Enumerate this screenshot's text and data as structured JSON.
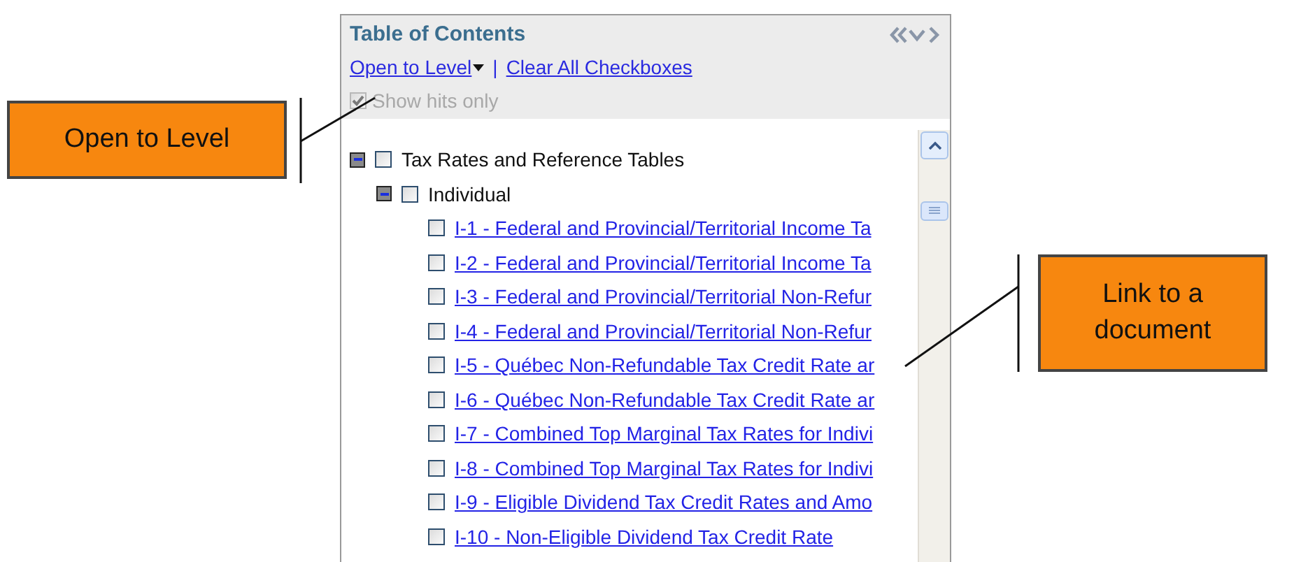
{
  "panel": {
    "title": "Table of Contents",
    "separator": "|",
    "toolbar": [
      {
        "label": "Open to Level",
        "has_menu": true
      },
      {
        "label": "Clear All Checkboxes",
        "has_menu": false
      }
    ],
    "show_hits_only": {
      "label": "Show hits only",
      "checked": true,
      "disabled": true
    },
    "tree": [
      {
        "label": "Tax Rates and Reference Tables",
        "kind": "folder",
        "expanded": true,
        "checked": false,
        "children": [
          {
            "label": "Individual",
            "kind": "folder",
            "expanded": true,
            "checked": false,
            "children": [
              {
                "label": "I-1 - Federal and Provincial/Territorial Income Ta",
                "kind": "link",
                "checked": false
              },
              {
                "label": "I-2 - Federal and Provincial/Territorial Income Ta",
                "kind": "link",
                "checked": false
              },
              {
                "label": "I-3 - Federal and Provincial/Territorial Non-Refur",
                "kind": "link",
                "checked": false
              },
              {
                "label": "I-4 - Federal and Provincial/Territorial Non-Refur",
                "kind": "link",
                "checked": false
              },
              {
                "label": "I-5 - Québec Non-Refundable Tax Credit Rate ar",
                "kind": "link",
                "checked": false
              },
              {
                "label": "I-6 - Québec Non-Refundable Tax Credit Rate ar",
                "kind": "link",
                "checked": false
              },
              {
                "label": "I-7 - Combined Top Marginal Tax Rates for Indivi",
                "kind": "link",
                "checked": false
              },
              {
                "label": "I-8 - Combined Top Marginal Tax Rates for Indivi",
                "kind": "link",
                "checked": false
              },
              {
                "label": "I-9 - Eligible Dividend Tax Credit Rates and Amo",
                "kind": "link",
                "checked": false
              },
              {
                "label": "I-10 - Non-Eligible Dividend Tax Credit Rate",
                "kind": "link",
                "checked": false
              }
            ]
          }
        ]
      }
    ]
  },
  "callouts": [
    {
      "text": "Open to Level"
    },
    {
      "text": "Link to a document"
    }
  ]
}
